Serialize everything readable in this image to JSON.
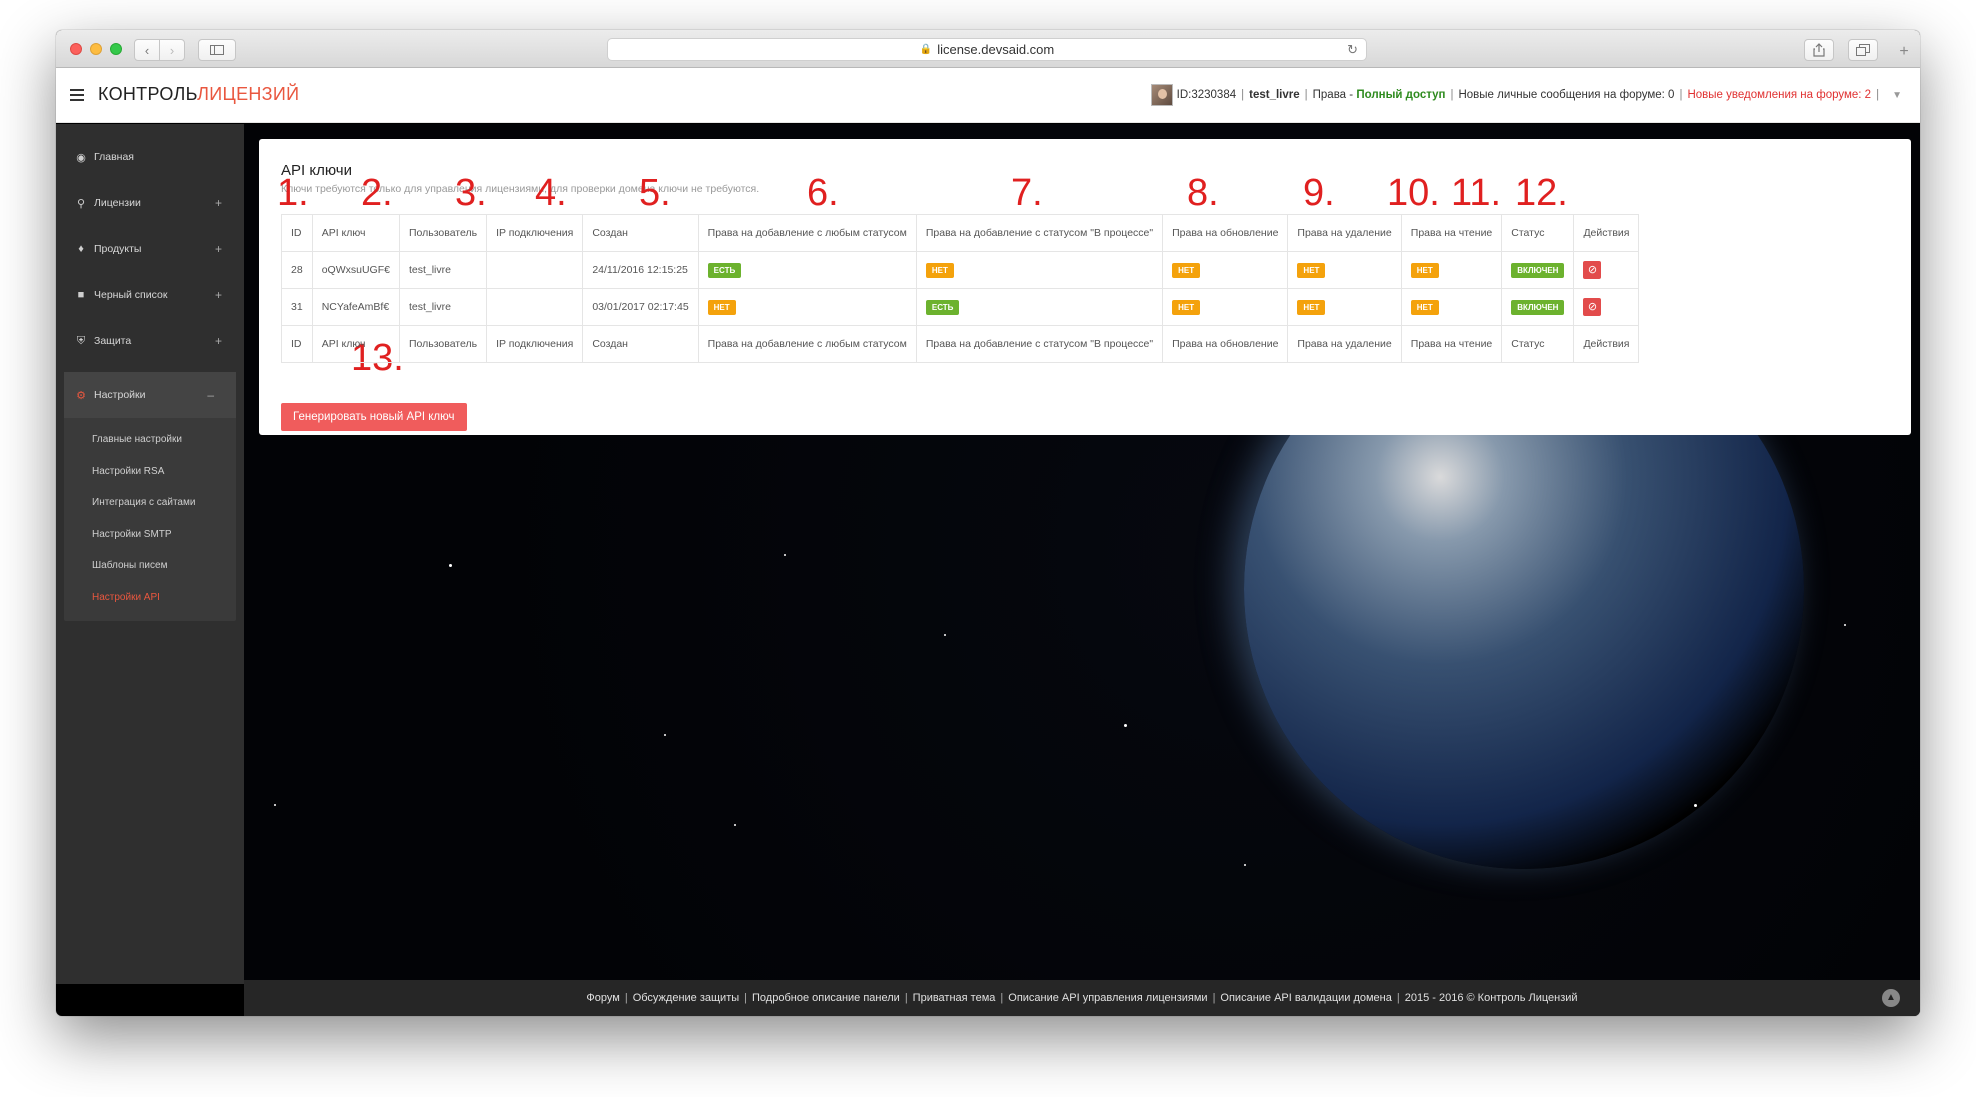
{
  "browser": {
    "url": "license.devsaid.com"
  },
  "header": {
    "brand_part1": "КОНТРОЛЬ",
    "brand_part2": "ЛИЦЕНЗИЙ",
    "user_id": "ID:3230384",
    "username": "test_livre",
    "rights_label": "Права -",
    "rights_value": "Полный доступ",
    "messages": "Новые личные сообщения на форуме: 0",
    "notifications": "Новые уведомления на форуме: 2"
  },
  "sidebar": {
    "items": [
      {
        "label": "Главная",
        "icon": "dashboard-icon"
      },
      {
        "label": "Лицензии",
        "icon": "key-icon"
      },
      {
        "label": "Продукты",
        "icon": "tags-icon"
      },
      {
        "label": "Черный список",
        "icon": "lock-icon"
      },
      {
        "label": "Защита",
        "icon": "shield-icon"
      }
    ],
    "settings": {
      "label": "Настройки",
      "icon": "gears-icon",
      "sub": [
        "Главные настройки",
        "Настройки RSA",
        "Интеграция с сайтами",
        "Настройки SMTP",
        "Шаблоны писем",
        "Настройки API"
      ]
    }
  },
  "card": {
    "title": "API ключи",
    "subtitle": "Ключи требуются только для управления лицензиями, для проверки домена ключи не требуются.",
    "columns": [
      "ID",
      "API ключ",
      "Пользователь",
      "IP подключения",
      "Создан",
      "Права на добавление с любым статусом",
      "Права на добавление с статусом \"В процессе\"",
      "Права на обновление",
      "Права на удаление",
      "Права на чтение",
      "Статус",
      "Действия"
    ],
    "rows": [
      {
        "id": "28",
        "key": "oQWxsuUGF€",
        "user": "test_livre",
        "ip": "",
        "created": "24/11/2016 12:15:25",
        "add_any": "ЕСТЬ",
        "add_progress": "НЕТ",
        "update": "НЕТ",
        "delete": "НЕТ",
        "read": "НЕТ",
        "status": "ВКЛЮЧЕН"
      },
      {
        "id": "31",
        "key": "NCYafeAmBf€",
        "user": "test_livre",
        "ip": "",
        "created": "03/01/2017 02:17:45",
        "add_any": "НЕТ",
        "add_progress": "ЕСТЬ",
        "update": "НЕТ",
        "delete": "НЕТ",
        "read": "НЕТ",
        "status": "ВКЛЮЧЕН"
      }
    ],
    "generate_button": "Генерировать новый API ключ"
  },
  "annotations": [
    "1.",
    "2.",
    "3.",
    "4.",
    "5.",
    "6.",
    "7.",
    "8.",
    "9.",
    "10.",
    "11.",
    "12.",
    "13."
  ],
  "footer": {
    "links": [
      "Форум",
      "Обсуждение защиты",
      "Подробное описание панели",
      "Приватная тема",
      "Описание API управления лицензиями",
      "Описание API валидации домена"
    ],
    "copyright": "2015 - 2016 © Контроль Лицензий"
  },
  "colors": {
    "accent": "#e9573f",
    "yes": "#6cb22e",
    "no": "#f4a20c",
    "danger": "#e24b4b"
  }
}
